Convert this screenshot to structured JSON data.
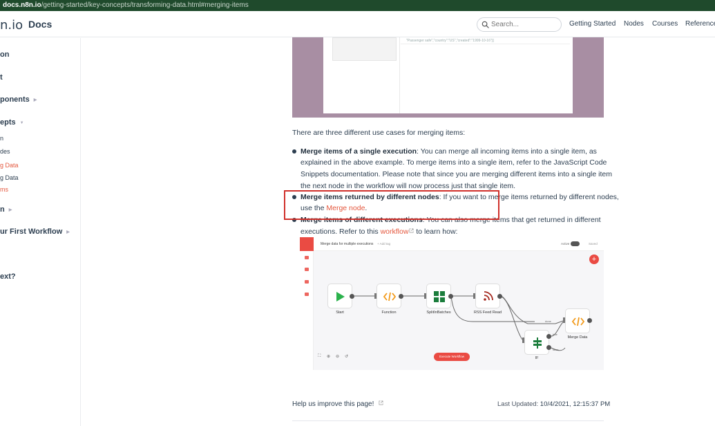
{
  "browser": {
    "domain": "docs.n8n.io",
    "path": "/getting-started/key-concepts/transforming-data.html#merging-items"
  },
  "header": {
    "logo": "n.io",
    "title": "Docs",
    "search_placeholder": "Search...",
    "nav": [
      "Getting Started",
      "Nodes",
      "Courses",
      "Reference"
    ]
  },
  "sidebar": {
    "items": [
      {
        "label": "on"
      },
      {
        "label": "t"
      },
      {
        "label": "ponents"
      },
      {
        "label": "epts"
      },
      {
        "label": "n"
      },
      {
        "label": "des"
      },
      {
        "label": "g Data"
      },
      {
        "label": "g Data"
      },
      {
        "label": "ms"
      },
      {
        "label": "n"
      },
      {
        "label": "ur First Workflow"
      },
      {
        "label": "ext?"
      }
    ]
  },
  "content": {
    "intro": "There are three different use cases for merging items:",
    "bullet1": {
      "bold": "Merge items of a single execution",
      "lines": [
        ": You can merge all incoming items into a single item, as",
        "explained in the above example. To merge items into a single item, refer to the JavaScript Code",
        "Snippets documentation. Please note that since you are merging different items into a single item",
        "the next node in the workflow will now process just that single item."
      ]
    },
    "bullet2": {
      "bold": "Merge items returned by different nodes",
      "line1": ": If you want to merge items returned by different nodes,",
      "line2_prefix": "use the ",
      "link": "Merge node",
      "line2_suffix": "."
    },
    "bullet3": {
      "bold": "Merge items of different executions",
      "line1": ": You can also merge items that get returned in different",
      "line2_prefix": "executions. Refer to this ",
      "link": "workflow",
      "line2_suffix": " to learn how:"
    }
  },
  "top_image": {
    "json_text": "\"Passenger safe\",\"country\":\"US\",\"created\":\"1999-10-16\"}]"
  },
  "workflow": {
    "title": "Merge data for multiple executions",
    "add_tag": "+ Add tag",
    "active_label": "Active",
    "saved_label": "Saved",
    "nodes": [
      "Start",
      "Function",
      "SplitInBatches",
      "RSS Feed Read",
      "IF",
      "Merge Data"
    ],
    "edge_labels": [
      "done",
      "true",
      "false"
    ],
    "execute_label": "Execute Workflow"
  },
  "footer": {
    "help": "Help us improve this page!",
    "updated_label": "Last Updated:",
    "updated_value": "10/4/2021, 12:15:37 PM"
  },
  "colors": {
    "accent": "#e4573d",
    "n8n_red": "#ea4b43",
    "highlight_box": "#d0302a",
    "url_bar": "#1f4a2c"
  }
}
